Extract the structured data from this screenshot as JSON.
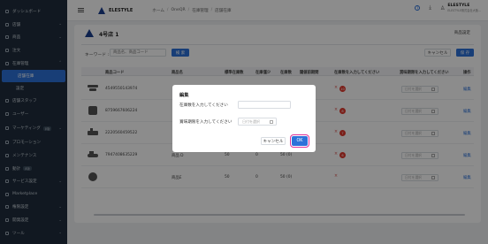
{
  "sidebar": {
    "items": [
      {
        "label": "ダッシュボード",
        "icon": "dashboard-icon",
        "chevron": false
      },
      {
        "label": "店舗",
        "icon": "store-icon",
        "chevron": true
      },
      {
        "label": "商品",
        "icon": "product-icon",
        "chevron": true
      },
      {
        "label": "注文",
        "icon": "order-icon",
        "chevron": false
      },
      {
        "label": "在庫管理",
        "icon": "inventory-icon",
        "chevron": true
      }
    ],
    "sub_items": [
      {
        "label": "店舗在庫",
        "active": true
      },
      {
        "label": "設定",
        "active": false
      }
    ],
    "items_after": [
      {
        "label": "店舗スタッフ",
        "icon": "staff-icon",
        "chevron": false,
        "tag": ""
      },
      {
        "label": "ユーザー",
        "icon": "user-icon",
        "chevron": false,
        "tag": ""
      },
      {
        "label": "マーケティング",
        "icon": "marketing-icon",
        "chevron": true,
        "tag": "β版"
      },
      {
        "label": "プロモーション",
        "icon": "promotion-icon",
        "chevron": false,
        "tag": ""
      },
      {
        "label": "メンテナンス",
        "icon": "maintenance-icon",
        "chevron": false,
        "tag": ""
      },
      {
        "label": "動計",
        "icon": "stats-icon",
        "chevron": false,
        "tag": "β版"
      },
      {
        "label": "サービス設定",
        "icon": "service-icon",
        "chevron": true,
        "tag": ""
      },
      {
        "label": "Marketplace",
        "icon": "marketplace-icon",
        "chevron": false,
        "tag": ""
      },
      {
        "label": "権限設定",
        "icon": "permission-icon",
        "chevron": true,
        "tag": ""
      },
      {
        "label": "開発設定",
        "icon": "dev-icon",
        "chevron": true,
        "tag": ""
      },
      {
        "label": "ツール",
        "icon": "tool-icon",
        "chevron": true,
        "tag": ""
      }
    ]
  },
  "header": {
    "brand": "ELESTYLE",
    "breadcrumbs": [
      "ホーム",
      "OneQR",
      "在庫管理",
      "店舗在庫"
    ],
    "user_name": "ELESTYLE",
    "user_sub": "ELESTYLE株式会社大阪..."
  },
  "main": {
    "store_title": "4号店 1",
    "store_settings_label": "商品設定",
    "keyword_label": "キーワード :",
    "keyword_placeholder": "商品名、商品コード",
    "search_label": "検 索",
    "cancel_label": "キャンセル",
    "save_label": "保 存",
    "columns": [
      "商品コード",
      "商品名",
      "標準在庫数",
      "在庫僅少",
      "在庫数",
      "閾値前期間",
      "在庫数を入力してください",
      "賞味期限を入力してください",
      "操作"
    ],
    "rows": [
      {
        "code": "4549550143974",
        "name": "",
        "standard": "",
        "low": "",
        "stock": "",
        "badge": "10",
        "date_placeholder": "日付を選択",
        "edit": "編集",
        "thumb": "thumb-1"
      },
      {
        "code": "8759667606224",
        "name": "",
        "standard": "",
        "low": "",
        "stock": "",
        "badge": "8",
        "date_placeholder": "日付を選択",
        "edit": "編集",
        "thumb": "thumb-2"
      },
      {
        "code": "2220560459522",
        "name": "",
        "standard": "",
        "low": "",
        "stock": "",
        "badge": "7",
        "date_placeholder": "日付を選択",
        "edit": "編集",
        "thumb": "thumb-3"
      },
      {
        "code": "7947408635229",
        "name": "商品 D",
        "standard": "50",
        "low": "0",
        "stock": "50 (0)",
        "badge": "6",
        "date_placeholder": "日付を選択",
        "edit": "編集",
        "thumb": "thumb-4"
      },
      {
        "code": "",
        "name": "商品E",
        "standard": "50",
        "low": "0",
        "stock": "50 (0)",
        "badge": "",
        "date_placeholder": "日付を選択",
        "edit": "編集",
        "thumb": "thumb-5"
      }
    ]
  },
  "modal": {
    "title": "編集",
    "stock_label": "在庫数を入力してください",
    "stock_value": "",
    "expiry_label": "賞味期限を入力してください",
    "expiry_placeholder": "日付を選択",
    "cancel_label": "キャンセル",
    "ok_label": "OK"
  },
  "colors": {
    "sidebar_bg": "#1f2d3d",
    "accent": "#2d72d9",
    "brand": "#1a3f8f",
    "badge": "#e03a2f",
    "highlight": "#e0339a"
  }
}
